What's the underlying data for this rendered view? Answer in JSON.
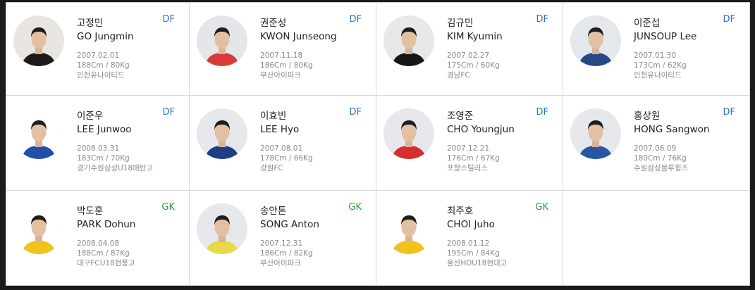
{
  "players": [
    {
      "kname": "고정민",
      "ename": "GO Jungmin",
      "position": "DF",
      "birth": "2007.02.01",
      "body": "188Cm / 80Kg",
      "team": "인천유나이티드",
      "kit": "#1a1a1a",
      "photo_bg": "#e9e6e1"
    },
    {
      "kname": "권준성",
      "ename": "KWON Junseong",
      "position": "DF",
      "birth": "2007.11.18",
      "body": "186Cm / 80Kg",
      "team": "부산아이파크",
      "kit": "#d83a3a",
      "photo_bg": "#e4e6ea"
    },
    {
      "kname": "김규민",
      "ename": "KIM Kyumin",
      "position": "DF",
      "birth": "2007.02.27",
      "body": "175Cm / 60Kg",
      "team": "경남FC",
      "kit": "#161616",
      "photo_bg": "#e8e8e8"
    },
    {
      "kname": "이준섭",
      "ename": "JUNSOUP Lee",
      "position": "DF",
      "birth": "2007.01.30",
      "body": "173Cm / 62Kg",
      "team": "인천유나이티드",
      "kit": "#234a86",
      "photo_bg": "#e4e7ec"
    },
    {
      "kname": "이준우",
      "ename": "LEE Junwoo",
      "position": "DF",
      "birth": "2008.03.31",
      "body": "183Cm / 70Kg",
      "team": "경기수원삼성U18매탄고",
      "kit": "#1f4fa8",
      "photo_bg": "#ffffff"
    },
    {
      "kname": "이효빈",
      "ename": "LEE Hyo",
      "position": "DF",
      "birth": "2007.08.01",
      "body": "178Cm / 66Kg",
      "team": "강원FC",
      "kit": "#1c3f86",
      "photo_bg": "#e6e8ec"
    },
    {
      "kname": "조영준",
      "ename": "CHO Youngjun",
      "position": "DF",
      "birth": "2007.12.21",
      "body": "176Cm / 67Kg",
      "team": "포항스틸러스",
      "kit": "#d42e2e",
      "photo_bg": "#e6e8ec"
    },
    {
      "kname": "홍상원",
      "ename": "HONG Sangwon",
      "position": "DF",
      "birth": "2007.06.09",
      "body": "180Cm / 76Kg",
      "team": "수원삼성블루윙즈",
      "kit": "#2756a7",
      "photo_bg": "#e6e8ec"
    },
    {
      "kname": "박도훈",
      "ename": "PARK Dohun",
      "position": "GK",
      "birth": "2008.04.08",
      "body": "188Cm / 87Kg",
      "team": "대구FCU18현풍고",
      "kit": "#f1c21b",
      "photo_bg": "#ffffff"
    },
    {
      "kname": "송안톤",
      "ename": "SONG Anton",
      "position": "GK",
      "birth": "2007.12.31",
      "body": "186Cm / 82Kg",
      "team": "부산아이파크",
      "kit": "#e8d84a",
      "photo_bg": "#e6e8ec"
    },
    {
      "kname": "최주호",
      "ename": "CHOI Juho",
      "position": "GK",
      "birth": "2008.01.12",
      "body": "195Cm / 84Kg",
      "team": "울산HDU18현대고",
      "kit": "#f1c21b",
      "photo_bg": "#ffffff"
    }
  ]
}
